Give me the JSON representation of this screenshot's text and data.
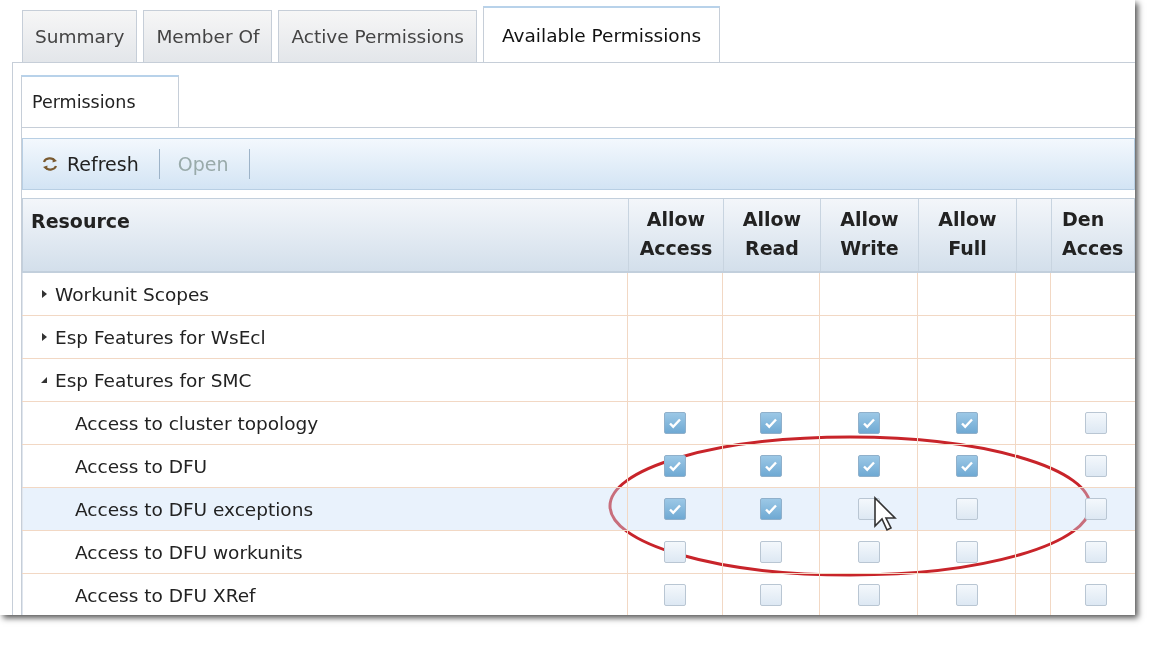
{
  "tabs": [
    {
      "label": "Summary",
      "selected": false
    },
    {
      "label": "Member Of",
      "selected": false
    },
    {
      "label": "Active Permissions",
      "selected": false
    },
    {
      "label": "Available Permissions",
      "selected": true
    }
  ],
  "subtabs": [
    {
      "label": "Permissions",
      "selected": true
    }
  ],
  "toolbar": [
    {
      "label": "Refresh",
      "disabled": false,
      "kind": "icon"
    },
    {
      "label": "Open",
      "disabled": true,
      "kind": "text"
    }
  ],
  "columns": [
    "Resource",
    "Allow\nAccess",
    "Allow\nRead",
    "Allow\nWrite",
    "Allow\nFull",
    "Den\nAcces"
  ],
  "resources": [
    {
      "label": "Workunit Scopes",
      "expanded": false,
      "selected": false
    },
    {
      "label": "Esp Features for WsEcl",
      "expanded": false,
      "selected": false
    },
    {
      "label": "Esp Features for SMC",
      "expanded": true,
      "selected": false,
      "children": [
        {
          "label": "Access to cluster topology",
          "selected": false,
          "checks": [
            true,
            true,
            true,
            true,
            false
          ]
        },
        {
          "label": "Access to DFU",
          "selected": false,
          "checks": [
            true,
            true,
            true,
            true,
            false
          ]
        },
        {
          "label": "Access to DFU exceptions",
          "selected": true,
          "checks": [
            true,
            true,
            false,
            false,
            false
          ]
        },
        {
          "label": "Access to DFU workunits",
          "selected": false,
          "checks": [
            false,
            false,
            false,
            false,
            false
          ]
        },
        {
          "label": "Access to DFU XRef",
          "selected": false,
          "checks": [
            false,
            false,
            false,
            false,
            false
          ]
        }
      ]
    }
  ]
}
